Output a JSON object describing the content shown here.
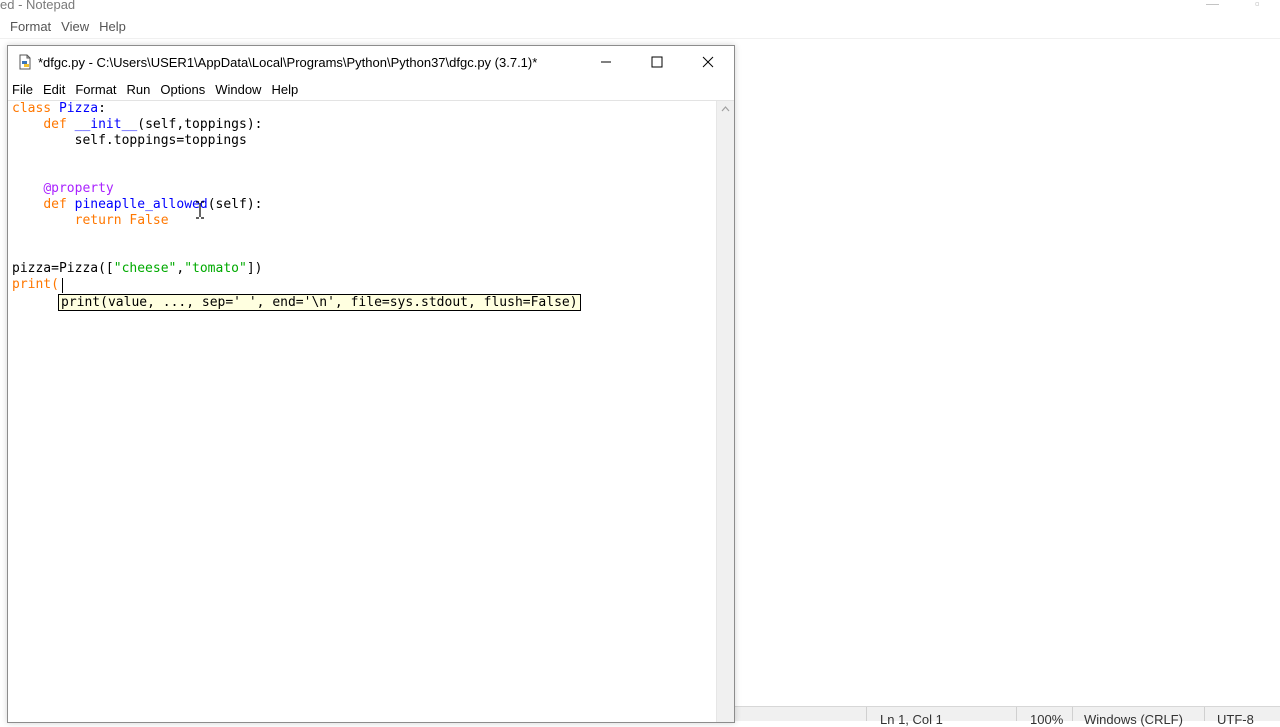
{
  "notepad": {
    "title": "ed - Notepad",
    "menu": [
      "Format",
      "View",
      "Help"
    ],
    "status": {
      "position": "Ln 1, Col 1",
      "zoom": "100%",
      "line_endings": "Windows (CRLF)",
      "encoding": "UTF-8"
    }
  },
  "idle": {
    "title": "*dfgc.py - C:\\Users\\USER1\\AppData\\Local\\Programs\\Python\\Python37\\dfgc.py (3.7.1)*",
    "menu": [
      "File",
      "Edit",
      "Format",
      "Run",
      "Options",
      "Window",
      "Help"
    ],
    "code": {
      "l1_kw": "class",
      "l1_name": "Pizza",
      "l1_rest": ":",
      "l2_kw": "def",
      "l2_name": "__init__",
      "l2_rest": "(self,toppings):",
      "l3": "self.toppings=toppings",
      "l4": "@property",
      "l5_kw": "def",
      "l5_name": "pineaplle_allowed",
      "l5_rest": "(self):",
      "l6_kw": "return",
      "l6_val": "False",
      "l7_a": "pizza=Pizza([",
      "l7_s1": "\"cheese\"",
      "l7_b": ",",
      "l7_s2": "\"tomato\"",
      "l7_c": "])",
      "l8": "print("
    },
    "calltip": "print(value, ..., sep=' ', end='\\n', file=sys.stdout, flush=False)"
  },
  "colors": {
    "keyword": "#ff7700",
    "definition": "#0000ff",
    "string": "#00aa00",
    "decorator": "#aa22ff",
    "calltip_bg": "#ffffe0"
  }
}
